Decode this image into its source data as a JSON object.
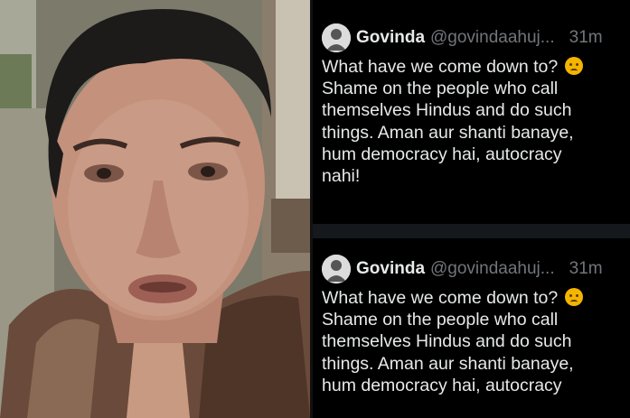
{
  "tweets": [
    {
      "name": "Govinda",
      "handle": "@govindaahuj...",
      "time": "31m",
      "lines": [
        "What have we come down to?",
        "Shame on the people who call",
        "themselves Hindus and do such",
        "things. Aman aur shanti banaye,",
        "hum democracy hai, autocracy",
        "nahi!"
      ],
      "emoji": "crying-face-emoji"
    },
    {
      "name": "Govinda",
      "handle": "@govindaahuj...",
      "time": "31m",
      "lines": [
        "What have we come down to?",
        "Shame on the people who call",
        "themselves Hindus and do such",
        "things. Aman aur shanti banaye,",
        "hum democracy hai, autocracy"
      ],
      "emoji": "crying-face-emoji"
    }
  ],
  "colors": {
    "background": "#000000",
    "text": "#e7e9ea",
    "secondary_text": "#71767b",
    "separator": "#15181c"
  }
}
